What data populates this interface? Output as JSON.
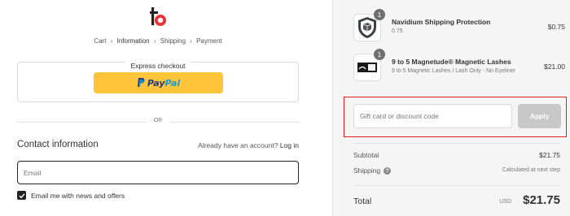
{
  "breadcrumb": {
    "cart": "Cart",
    "information": "Information",
    "shipping": "Shipping",
    "payment": "Payment"
  },
  "express": {
    "title": "Express checkout",
    "paypal_a": "Pay",
    "paypal_b": "Pal"
  },
  "divider": {
    "text": "OR"
  },
  "contact": {
    "title": "Contact information",
    "account_question": "Already have an account?",
    "login": "Log in",
    "email_placeholder": "Email",
    "newsletter_label": "Email me with news and offers",
    "newsletter_checked": true
  },
  "cart": {
    "items": [
      {
        "name": "Navidium Shipping Protection",
        "variant": "0.75",
        "price": "$0.75",
        "qty": "1"
      },
      {
        "name": "9 to 5 Magnetude® Magnetic Lashes",
        "variant": "9 to 5 Magnetic Lashes / Lash Only - No Eyeliner",
        "price": "$21.00",
        "qty": "1"
      }
    ]
  },
  "discount": {
    "placeholder": "Gift card or discount code",
    "apply": "Apply"
  },
  "summary": {
    "subtotal_label": "Subtotal",
    "subtotal": "$21.75",
    "shipping_label": "Shipping",
    "shipping_help": "?",
    "shipping": "Calculated at next step",
    "total_label": "Total",
    "currency": "USD",
    "total": "$21.75"
  },
  "colors": {
    "accent_red": "#e01b1b",
    "paypal_yellow": "#ffc439",
    "logo_red": "#e8333a"
  }
}
